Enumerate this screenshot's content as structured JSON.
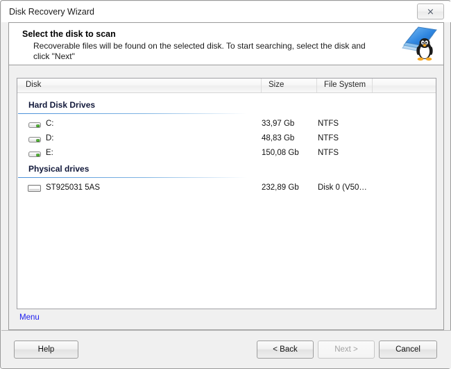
{
  "window": {
    "title": "Disk Recovery Wizard",
    "close_glyph": "⨯"
  },
  "header": {
    "title": "Select the disk to scan",
    "description": "Recoverable files will be found on the selected disk. To start searching, select the disk and click \"Next\"",
    "logo_icon": "disk-penguin-logo"
  },
  "disk_list": {
    "columns": [
      {
        "label": "Disk"
      },
      {
        "label": "Size"
      },
      {
        "label": "File System"
      },
      {
        "label": ""
      }
    ],
    "groups": [
      {
        "label": "Hard Disk Drives",
        "rows": [
          {
            "icon": "volume-icon",
            "name": "C:",
            "size": "33,97 Gb",
            "fs": "NTFS"
          },
          {
            "icon": "volume-icon",
            "name": "D:",
            "size": "48,83 Gb",
            "fs": "NTFS"
          },
          {
            "icon": "volume-icon",
            "name": "E:",
            "size": "150,08 Gb",
            "fs": "NTFS"
          }
        ]
      },
      {
        "label": "Physical drives",
        "rows": [
          {
            "icon": "hdd-icon",
            "name": "ST925031 5AS",
            "size": "232,89 Gb",
            "fs": "Disk 0 (V50…"
          }
        ]
      }
    ]
  },
  "menu": {
    "label": "Menu"
  },
  "footer": {
    "help_label": "Help",
    "back_label": "< Back",
    "next_label": "Next >",
    "cancel_label": "Cancel",
    "next_enabled": false
  },
  "colors": {
    "window_bg": "#f0f0f0",
    "panel_bg": "#ffffff",
    "link": "#1a1aee",
    "group_rule": "#4a90d9",
    "group_text": "#11183a",
    "disabled_text": "#a2a2a2"
  }
}
